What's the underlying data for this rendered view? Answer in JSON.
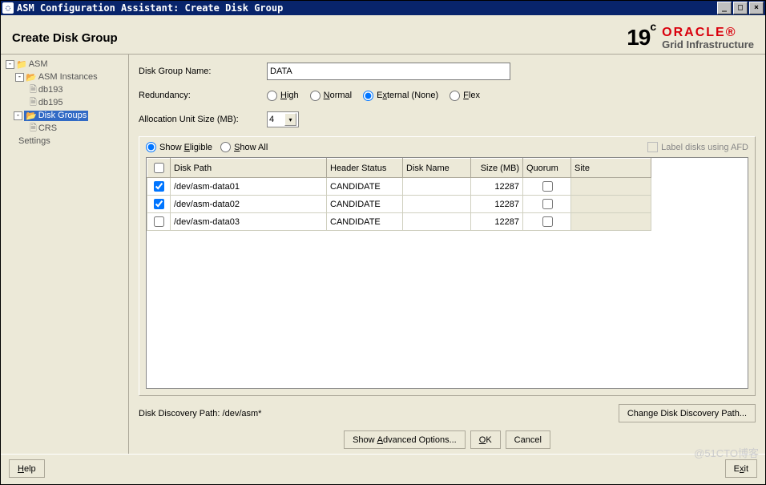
{
  "window": {
    "title": "ASM Configuration Assistant: Create Disk Group"
  },
  "header": {
    "title": "Create Disk Group",
    "brand_num": "19",
    "brand_sup": "c",
    "brand_name": "ORACLE",
    "brand_sub": "Grid Infrastructure"
  },
  "tree": {
    "root": "ASM",
    "instances_label": "ASM Instances",
    "inst1": "db193",
    "inst2": "db195",
    "disk_groups_label": "Disk Groups",
    "crs": "CRS",
    "settings": "Settings"
  },
  "form": {
    "name_label": "Disk Group Name:",
    "name_value": "DATA",
    "redundancy_label": "Redundancy:",
    "r_high": "High",
    "r_normal": "Normal",
    "r_external": "External (None)",
    "r_flex": "Flex",
    "alloc_label": "Allocation Unit Size (MB):",
    "alloc_value": "4"
  },
  "panel": {
    "show_eligible": "Show Eligible",
    "show_all": "Show All",
    "afd_label": "Label disks using AFD",
    "cols": {
      "path": "Disk Path",
      "header": "Header Status",
      "name": "Disk Name",
      "size": "Size (MB)",
      "quorum": "Quorum",
      "site": "Site"
    },
    "rows": [
      {
        "checked": true,
        "path": "/dev/asm-data01",
        "header": "CANDIDATE",
        "name": "",
        "size": "12287",
        "quorum": false
      },
      {
        "checked": true,
        "path": "/dev/asm-data02",
        "header": "CANDIDATE",
        "name": "",
        "size": "12287",
        "quorum": false
      },
      {
        "checked": false,
        "path": "/dev/asm-data03",
        "header": "CANDIDATE",
        "name": "",
        "size": "12287",
        "quorum": false
      }
    ]
  },
  "discovery": {
    "label": "Disk Discovery Path: /dev/asm*",
    "change_btn": "Change Disk Discovery Path..."
  },
  "buttons": {
    "adv": "Show Advanced Options...",
    "ok": "OK",
    "cancel": "Cancel",
    "help": "Help",
    "exit": "Exit"
  },
  "watermark": "@51CTO博客"
}
